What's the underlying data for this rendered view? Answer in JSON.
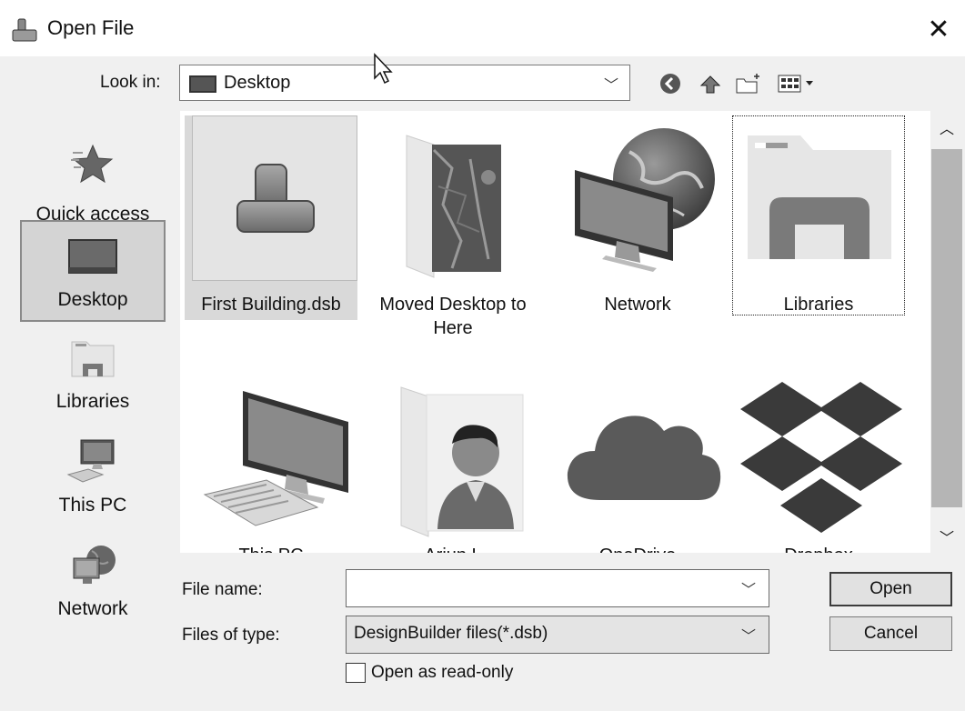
{
  "window": {
    "title": "Open File",
    "close_glyph": "✕"
  },
  "lookin": {
    "label": "Look in:",
    "value": "Desktop"
  },
  "toolbar": [
    "back-icon",
    "up-folder-icon",
    "new-folder-icon",
    "view-menu-icon"
  ],
  "places": [
    {
      "label": "Quick access",
      "icon": "star-icon"
    },
    {
      "label": "Desktop",
      "icon": "desktop-icon",
      "selected": true
    },
    {
      "label": "Libraries",
      "icon": "libraries-icon"
    },
    {
      "label": "This PC",
      "icon": "computer-icon"
    },
    {
      "label": "Network",
      "icon": "network-icon"
    }
  ],
  "files": [
    {
      "label": "First Building.dsb",
      "icon": "designbuilder-file-icon",
      "selected": true,
      "checkbox": true
    },
    {
      "label": "Moved Desktop to Here",
      "icon": "photo-folder-icon"
    },
    {
      "label": "Network",
      "icon": "network-globe-icon"
    },
    {
      "label": "Libraries",
      "icon": "libraries-folder-icon",
      "focused": true
    },
    {
      "label": "This PC",
      "icon": "this-pc-icon"
    },
    {
      "label": "Arjun L",
      "icon": "user-folder-icon"
    },
    {
      "label": "OneDrive",
      "icon": "onedrive-icon"
    },
    {
      "label": "Dropbox",
      "icon": "dropbox-icon"
    }
  ],
  "form": {
    "filename_label": "File name:",
    "filename_value": "",
    "filetype_label": "Files of type:",
    "filetype_value": "DesignBuilder files(*.dsb)",
    "readonly_label": "Open as read-only",
    "readonly_checked": false
  },
  "buttons": {
    "open": "Open",
    "cancel": "Cancel"
  }
}
